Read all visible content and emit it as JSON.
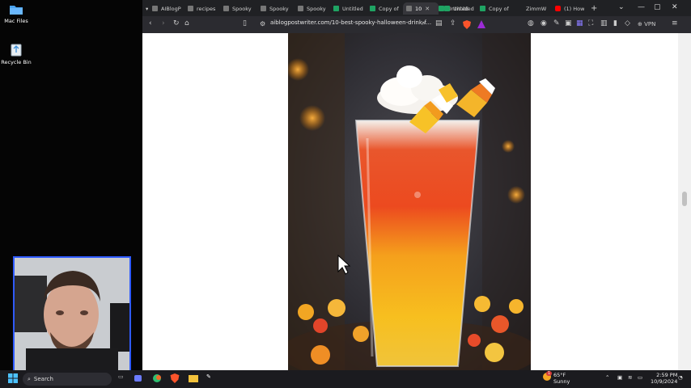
{
  "desktop": {
    "icons": [
      {
        "label": "Mac Files",
        "icon": "folder-icon"
      },
      {
        "label": "Recycle Bin",
        "icon": "recycle-bin-icon"
      }
    ]
  },
  "browser": {
    "tabs": [
      {
        "title": "AIBlogP",
        "icon": "page"
      },
      {
        "title": "recipes",
        "icon": "page"
      },
      {
        "title": "Spooky",
        "icon": "page"
      },
      {
        "title": "Spooky",
        "icon": "page"
      },
      {
        "title": "Spooky",
        "icon": "page"
      },
      {
        "title": "Untitled",
        "icon": "sheets"
      },
      {
        "title": "Copy of",
        "icon": "sheets"
      },
      {
        "title": "10",
        "icon": "page",
        "active": true
      },
      {
        "title": "Untitled",
        "icon": "sheets"
      },
      {
        "title": "Untitled",
        "icon": "sheets"
      },
      {
        "title": "Copy of",
        "icon": "sheets"
      },
      {
        "title": "ZimmW",
        "icon": "none"
      },
      {
        "title": "(1) How",
        "icon": "youtube"
      }
    ],
    "new_tab": "+",
    "url": "aiblogpostwriter.com/10-best-spooky-halloween-drink-f...",
    "vpn_label": "VPN"
  },
  "taskbar": {
    "search_placeholder": "Search",
    "weather": {
      "temp": "65°F",
      "condition": "Sunny",
      "badge": "1"
    },
    "clock": {
      "time": "2:59 PM",
      "date": "10/9/2024"
    }
  },
  "colors": {
    "accent": "#2f5bff",
    "brave": "#fb542b"
  }
}
